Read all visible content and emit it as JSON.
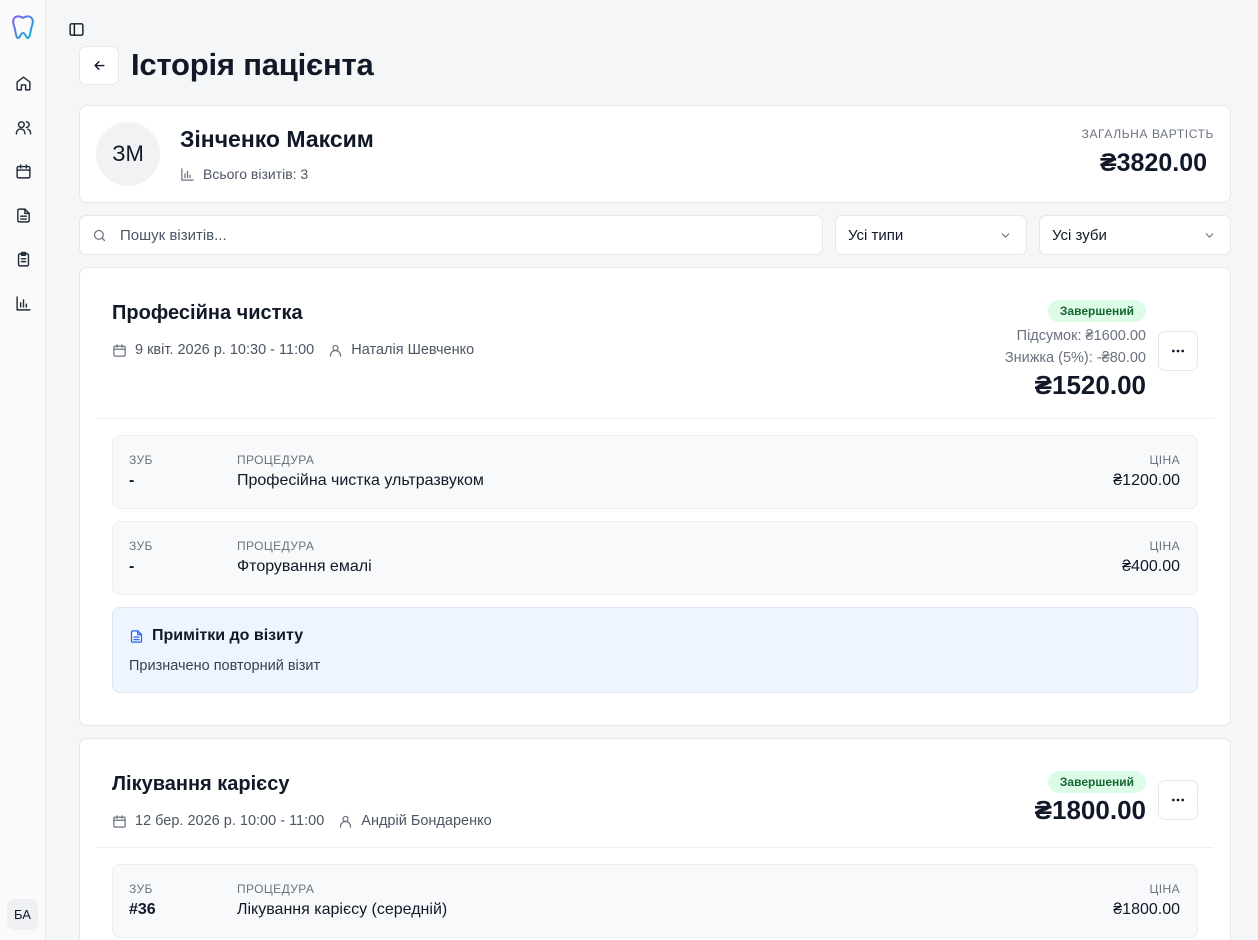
{
  "sidebar": {
    "nav": [
      {
        "icon": "home-icon"
      },
      {
        "icon": "users-icon"
      },
      {
        "icon": "calendar-icon"
      },
      {
        "icon": "document-icon"
      },
      {
        "icon": "clipboard-icon"
      },
      {
        "icon": "bar-chart-icon"
      }
    ],
    "user_initials": "БА"
  },
  "header": {
    "title": "Історія пацієнта"
  },
  "patient": {
    "initials": "ЗМ",
    "name": "Зінченко Максим",
    "visits_label": "Всього візитів: 3",
    "total_label": "ЗАГАЛЬНА ВАРТІСТЬ",
    "total_value": "₴3820.00"
  },
  "filters": {
    "search_placeholder": "Пошук візитів...",
    "type_select": "Усі типи",
    "tooth_select": "Усі зуби"
  },
  "labels": {
    "tooth": "ЗУБ",
    "procedure": "ПРОЦЕДУРА",
    "price": "ЦІНА"
  },
  "visits": [
    {
      "title": "Професійна чистка",
      "date": "9 квіт. 2026 р. 10:30 - 11:00",
      "doctor": "Наталія Шевченко",
      "status": "Завершений",
      "subtotal": "Підсумок: ₴1600.00",
      "discount": "Знижка (5%): -₴80.00",
      "price": "₴1520.00",
      "procedures": [
        {
          "tooth": "-",
          "name": "Професійна чистка ультразвуком",
          "price": "₴1200.00"
        },
        {
          "tooth": "-",
          "name": "Фторування емалі",
          "price": "₴400.00"
        }
      ],
      "notes_title": "Примітки до візиту",
      "notes_text": "Призначено повторний візит"
    },
    {
      "title": "Лікування карієсу",
      "date": "12 бер. 2026 р. 10:00 - 11:00",
      "doctor": "Андрій Бондаренко",
      "status": "Завершений",
      "price": "₴1800.00",
      "procedures": [
        {
          "tooth": "#36",
          "name": "Лікування карієсу (середній)",
          "price": "₴1800.00"
        }
      ]
    }
  ],
  "colors": {
    "status_bg": "#dcfce7",
    "status_text": "#166534",
    "notes_bg": "#eff5ff",
    "notes_icon": "#2563eb"
  }
}
